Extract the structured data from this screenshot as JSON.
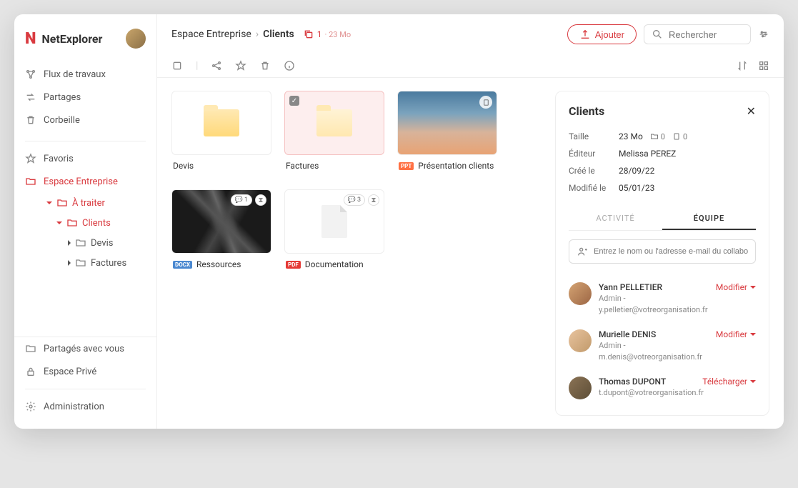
{
  "brand": {
    "name": "NetExplorer"
  },
  "sidebar": {
    "nav": [
      {
        "label": "Flux de travaux"
      },
      {
        "label": "Partages"
      },
      {
        "label": "Corbeille"
      }
    ],
    "favorites_label": "Favoris",
    "workspace_label": "Espace Entreprise",
    "tree": {
      "a_traiter": "À traiter",
      "clients": "Clients",
      "devis": "Devis",
      "factures": "Factures"
    },
    "bottom": [
      {
        "label": "Partagés avec vous"
      },
      {
        "label": "Espace Privé"
      },
      {
        "label": "Administration"
      }
    ]
  },
  "breadcrumb": {
    "root": "Espace Entreprise",
    "current": "Clients",
    "count": "1",
    "size": "· 23 Mo"
  },
  "actions": {
    "add": "Ajouter",
    "search_placeholder": "Rechercher"
  },
  "items": {
    "devis": "Devis",
    "factures": "Factures",
    "presentation": "Présentation clients",
    "ressources": "Ressources",
    "documentation": "Documentation"
  },
  "tags": {
    "ppt": "PPT",
    "docx": "DOCX",
    "pdf": "PDF"
  },
  "badges": {
    "comment1": "1",
    "comment3": "3"
  },
  "details": {
    "title": "Clients",
    "meta": {
      "size_label": "Taille",
      "size_value": "23 Mo",
      "folders": "0",
      "files": "0",
      "editor_label": "Éditeur",
      "editor_value": "Melissa PEREZ",
      "created_label": "Créé le",
      "created_value": "28/09/22",
      "modified_label": "Modifié le",
      "modified_value": "05/01/23"
    },
    "tabs": {
      "activity": "ACTIVITÉ",
      "team": "ÉQUIPE"
    },
    "collab_placeholder": "Entrez le nom ou l'adresse e-mail du collaborateur",
    "members": [
      {
        "name": "Yann PELLETIER",
        "role": "Admin - ",
        "email": "y.pelletier@votreorganisation.fr",
        "action": "Modifier"
      },
      {
        "name": "Murielle DENIS",
        "role": "Admin - ",
        "email": "m.denis@votreorganisation.fr",
        "action": "Modifier"
      },
      {
        "name": "Thomas DUPONT",
        "role": "",
        "email": "t.dupont@votreorganisation.fr",
        "action": "Télécharger"
      }
    ]
  }
}
